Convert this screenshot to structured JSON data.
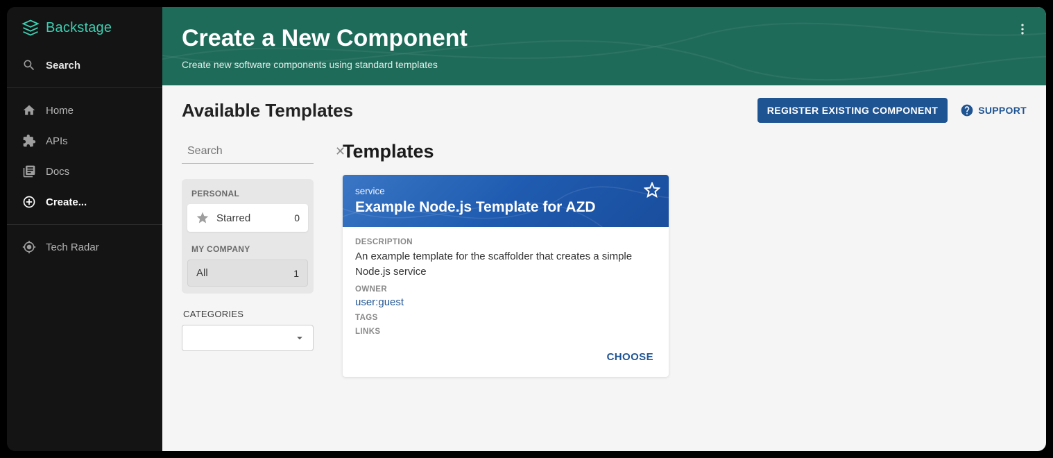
{
  "brand": {
    "name": "Backstage"
  },
  "sidebar": {
    "search_label": "Search",
    "items": [
      {
        "label": "Home",
        "icon": "home-icon",
        "active": false
      },
      {
        "label": "APIs",
        "icon": "puzzle-icon",
        "active": false
      },
      {
        "label": "Docs",
        "icon": "docs-icon",
        "active": false
      },
      {
        "label": "Create...",
        "icon": "plus-circle-icon",
        "active": true
      }
    ],
    "footer_item": {
      "label": "Tech Radar",
      "icon": "target-icon"
    }
  },
  "hero": {
    "title": "Create a New Component",
    "subtitle": "Create new software components using standard templates"
  },
  "bar": {
    "heading": "Available Templates",
    "register_btn": "REGISTER EXISTING COMPONENT",
    "support_label": "SUPPORT"
  },
  "filters": {
    "search_placeholder": "Search",
    "personal_label": "PERSONAL",
    "starred_label": "Starred",
    "starred_count": "0",
    "company_label": "MY COMPANY",
    "all_label": "All",
    "all_count": "1",
    "categories_label": "CATEGORIES"
  },
  "templates": {
    "section_title": "Templates",
    "card": {
      "kind": "service",
      "title": "Example Node.js Template for AZD",
      "description_label": "DESCRIPTION",
      "description": "An example template for the scaffolder that creates a simple Node.js service",
      "owner_label": "OWNER",
      "owner": "user:guest",
      "tags_label": "TAGS",
      "links_label": "LINKS",
      "choose_label": "CHOOSE"
    }
  }
}
